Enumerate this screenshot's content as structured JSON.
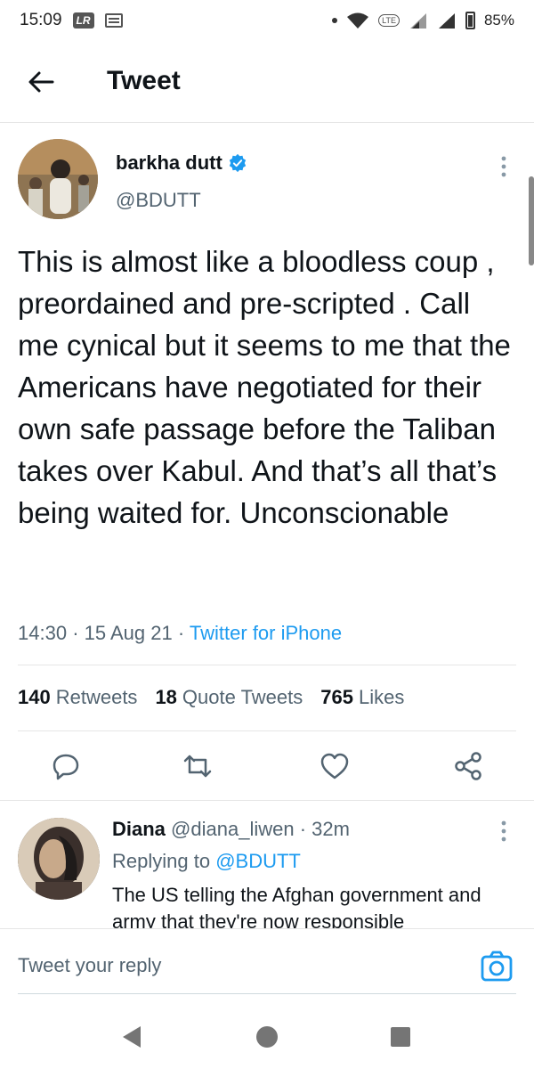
{
  "status_bar": {
    "time": "15:09",
    "badge": "LR",
    "network": "LTE",
    "battery": "85%"
  },
  "header": {
    "title": "Tweet"
  },
  "tweet": {
    "author_name": "barkha dutt",
    "author_handle": "@BDUTT",
    "text": "This is almost like a bloodless coup , preordained and pre-scripted . Call me cynical but it seems to me that the Americans have negotiated for their own safe passage before the Taliban takes over Kabul. And that’s all that’s being waited for. Unconscionable",
    "time": "14:30",
    "date": "15 Aug 21",
    "source": "Twitter for iPhone",
    "stats": {
      "retweets_count": "140",
      "retweets_label": "Retweets",
      "quotes_count": "18",
      "quotes_label": "Quote Tweets",
      "likes_count": "765",
      "likes_label": "Likes"
    }
  },
  "reply": {
    "name": "Diana",
    "handle": "@diana_liwen",
    "age": "32m",
    "replying_label": "Replying to",
    "replying_to": "@BDUTT",
    "text": "The US telling the Afghan government and army that they're now responsible"
  },
  "compose": {
    "placeholder": "Tweet your reply"
  },
  "colors": {
    "accent": "#1d9bf0",
    "text": "#0f1419",
    "secondary": "#536471"
  },
  "icons": [
    "back-arrow-icon",
    "verified-badge-icon",
    "more-vertical-icon",
    "reply-icon",
    "retweet-icon",
    "like-icon",
    "share-icon",
    "camera-icon",
    "nav-back-icon",
    "nav-home-icon",
    "nav-recents-icon"
  ]
}
